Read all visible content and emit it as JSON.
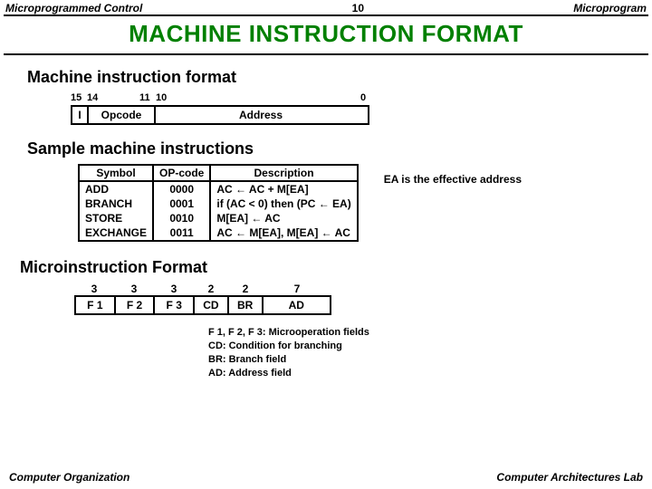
{
  "header": {
    "left": "Microprogrammed Control",
    "center": "10",
    "right": "Microprogram"
  },
  "title": "MACHINE  INSTRUCTION  FORMAT",
  "mif": {
    "heading": "Machine instruction format",
    "bits": {
      "b15": "15",
      "b14": "14",
      "b11": "11",
      "b10": "10",
      "b0": "0"
    },
    "cells": {
      "i": "I",
      "opcode": "Opcode",
      "address": "Address"
    }
  },
  "sample": {
    "heading": "Sample machine instructions",
    "cols": {
      "sym": "Symbol",
      "op": "OP-code",
      "desc": "Description"
    },
    "rows": [
      {
        "sym": "ADD",
        "op": "0000",
        "desc": "AC ← AC + M[EA]"
      },
      {
        "sym": "BRANCH",
        "op": "0001",
        "desc": "if (AC < 0) then (PC ← EA)"
      },
      {
        "sym": "STORE",
        "op": "0010",
        "desc": "M[EA] ← AC"
      },
      {
        "sym": "EXCHANGE",
        "op": "0011",
        "desc": "AC ← M[EA], M[EA] ← AC"
      }
    ],
    "note": "EA is the effective address"
  },
  "micro": {
    "heading": "Microinstruction Format",
    "widths": {
      "w3a": "3",
      "w3b": "3",
      "w3c": "3",
      "w2a": "2",
      "w2b": "2",
      "w7": "7"
    },
    "cells": {
      "f1": "F 1",
      "f2": "F 2",
      "f3": "F 3",
      "cd": "CD",
      "br": "BR",
      "ad": "AD"
    },
    "legend": {
      "l1": "F 1, F 2, F 3: Microoperation fields",
      "l2": "CD: Condition for branching",
      "l3": "BR: Branch field",
      "l4": "AD: Address field"
    }
  },
  "footer": {
    "left": "Computer Organization",
    "right": "Computer Architectures Lab"
  }
}
